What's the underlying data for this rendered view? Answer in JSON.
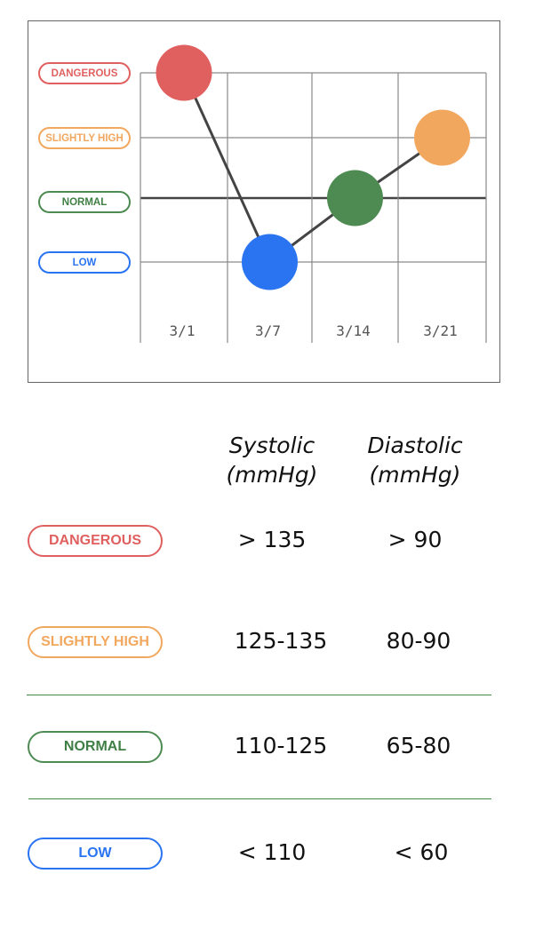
{
  "chart_data": {
    "type": "line",
    "categories": [
      "3/1",
      "3/7",
      "3/14",
      "3/21"
    ],
    "y_levels": [
      "LOW",
      "NORMAL",
      "SLIGHTLY HIGH",
      "DANGEROUS"
    ],
    "values": [
      "DANGEROUS",
      "LOW",
      "NORMAL",
      "SLIGHTLY HIGH"
    ],
    "title": "",
    "xlabel": "",
    "ylabel": "",
    "grid": true,
    "level_colors": {
      "DANGEROUS": "#e06060",
      "SLIGHTLY HIGH": "#f2a75f",
      "NORMAL": "#4e8b52",
      "LOW": "#2a74f2"
    }
  },
  "axis_labels": {
    "dangerous": "DANGEROUS",
    "slightly_high": "SLIGHTLY HIGH",
    "normal": "NORMAL",
    "low": "LOW"
  },
  "table": {
    "systolic_header": [
      "Systolic",
      "(mmHg)"
    ],
    "diastolic_header": [
      "Diastolic",
      "(mmHg)"
    ],
    "rows": [
      {
        "level": "DANGEROUS",
        "systolic": "> 135",
        "diastolic": "> 90",
        "color": "#e06060"
      },
      {
        "level": "SLIGHTLY HIGH",
        "systolic": "125-135",
        "diastolic": "80-90",
        "color": "#f2a75f"
      },
      {
        "level": "NORMAL",
        "systolic": "110-125",
        "diastolic": "65-80",
        "color": "#4e8b52"
      },
      {
        "level": "LOW",
        "systolic": "< 110",
        "diastolic": "< 60",
        "color": "#2a74f2"
      }
    ]
  }
}
